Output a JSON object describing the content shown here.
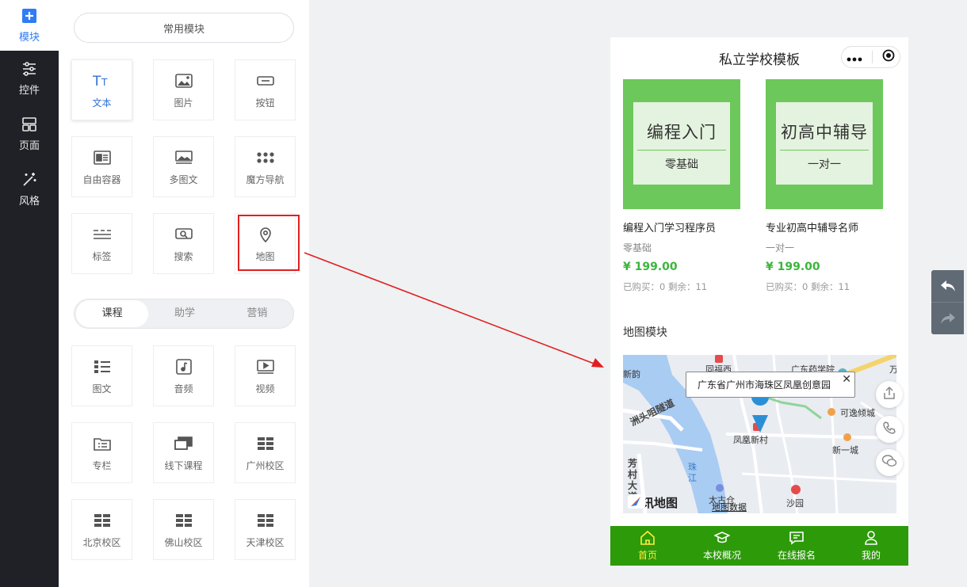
{
  "rail": {
    "items": [
      {
        "label": "模块",
        "icon": "plus-square-icon",
        "active": true
      },
      {
        "label": "控件",
        "icon": "sliders-icon"
      },
      {
        "label": "页面",
        "icon": "page-layout-icon"
      },
      {
        "label": "风格",
        "icon": "magic-wand-icon"
      }
    ]
  },
  "panel": {
    "common_label": "常用模块",
    "common_tiles": [
      {
        "label": "文本",
        "icon": "text-icon"
      },
      {
        "label": "图片",
        "icon": "image-icon"
      },
      {
        "label": "按钮",
        "icon": "button-icon"
      },
      {
        "label": "自由容器",
        "icon": "container-icon"
      },
      {
        "label": "多图文",
        "icon": "multi-image-icon"
      },
      {
        "label": "魔方导航",
        "icon": "grid-dots-icon"
      },
      {
        "label": "标签",
        "icon": "tag-lines-icon"
      },
      {
        "label": "搜索",
        "icon": "search-icon"
      },
      {
        "label": "地图",
        "icon": "map-pin-icon"
      }
    ],
    "tabs": [
      "课程",
      "助学",
      "营销"
    ],
    "course_tiles": [
      {
        "label": "图文",
        "icon": "list-image-icon"
      },
      {
        "label": "音频",
        "icon": "audio-icon"
      },
      {
        "label": "视频",
        "icon": "video-icon"
      },
      {
        "label": "专栏",
        "icon": "folder-icon"
      },
      {
        "label": "线下课程",
        "icon": "offline-course-icon"
      },
      {
        "label": "广州校区",
        "icon": "campus-grid-icon"
      },
      {
        "label": "北京校区",
        "icon": "campus-grid-icon"
      },
      {
        "label": "佛山校区",
        "icon": "campus-grid-icon"
      },
      {
        "label": "天津校区",
        "icon": "campus-grid-icon"
      }
    ]
  },
  "phone": {
    "title": "私立学校模板",
    "cards": [
      {
        "big": "编程入门",
        "small": "零基础",
        "name": "编程入门学习程序员",
        "sub": "零基础",
        "price": "¥ 199.00",
        "stat": "已购买：0 剩余：11"
      },
      {
        "big": "初高中辅导",
        "small": "一对一",
        "name": "专业初高中辅导名师",
        "sub": "一对一",
        "price": "¥ 199.00",
        "stat": "已购买：0 剩余：11"
      }
    ],
    "map_title": "地图模块",
    "map": {
      "address": "广东省广州市海珠区凤凰创意园",
      "close": "✕",
      "labels": [
        "新韵",
        "同福西",
        "广东药学院",
        "万",
        "洲头咀隧道",
        "可逸倾城",
        "凤凰新村",
        "新一城",
        "芳村大道",
        "珠江",
        "太古仓",
        "沙园"
      ],
      "logo": "腾讯地图",
      "data_link": "地图数据"
    },
    "tabbar": [
      {
        "label": "首页",
        "icon": "home-icon",
        "active": true
      },
      {
        "label": "本校概况",
        "icon": "graduation-cap-icon"
      },
      {
        "label": "在线报名",
        "icon": "message-icon"
      },
      {
        "label": "我的",
        "icon": "user-icon"
      }
    ]
  },
  "colors": {
    "accent_blue": "#2f7cf6",
    "tabbar_green": "#2d9a0a",
    "card_green": "#6cc85a",
    "price_green": "#3cb53c",
    "highlight_red": "#e02020"
  }
}
